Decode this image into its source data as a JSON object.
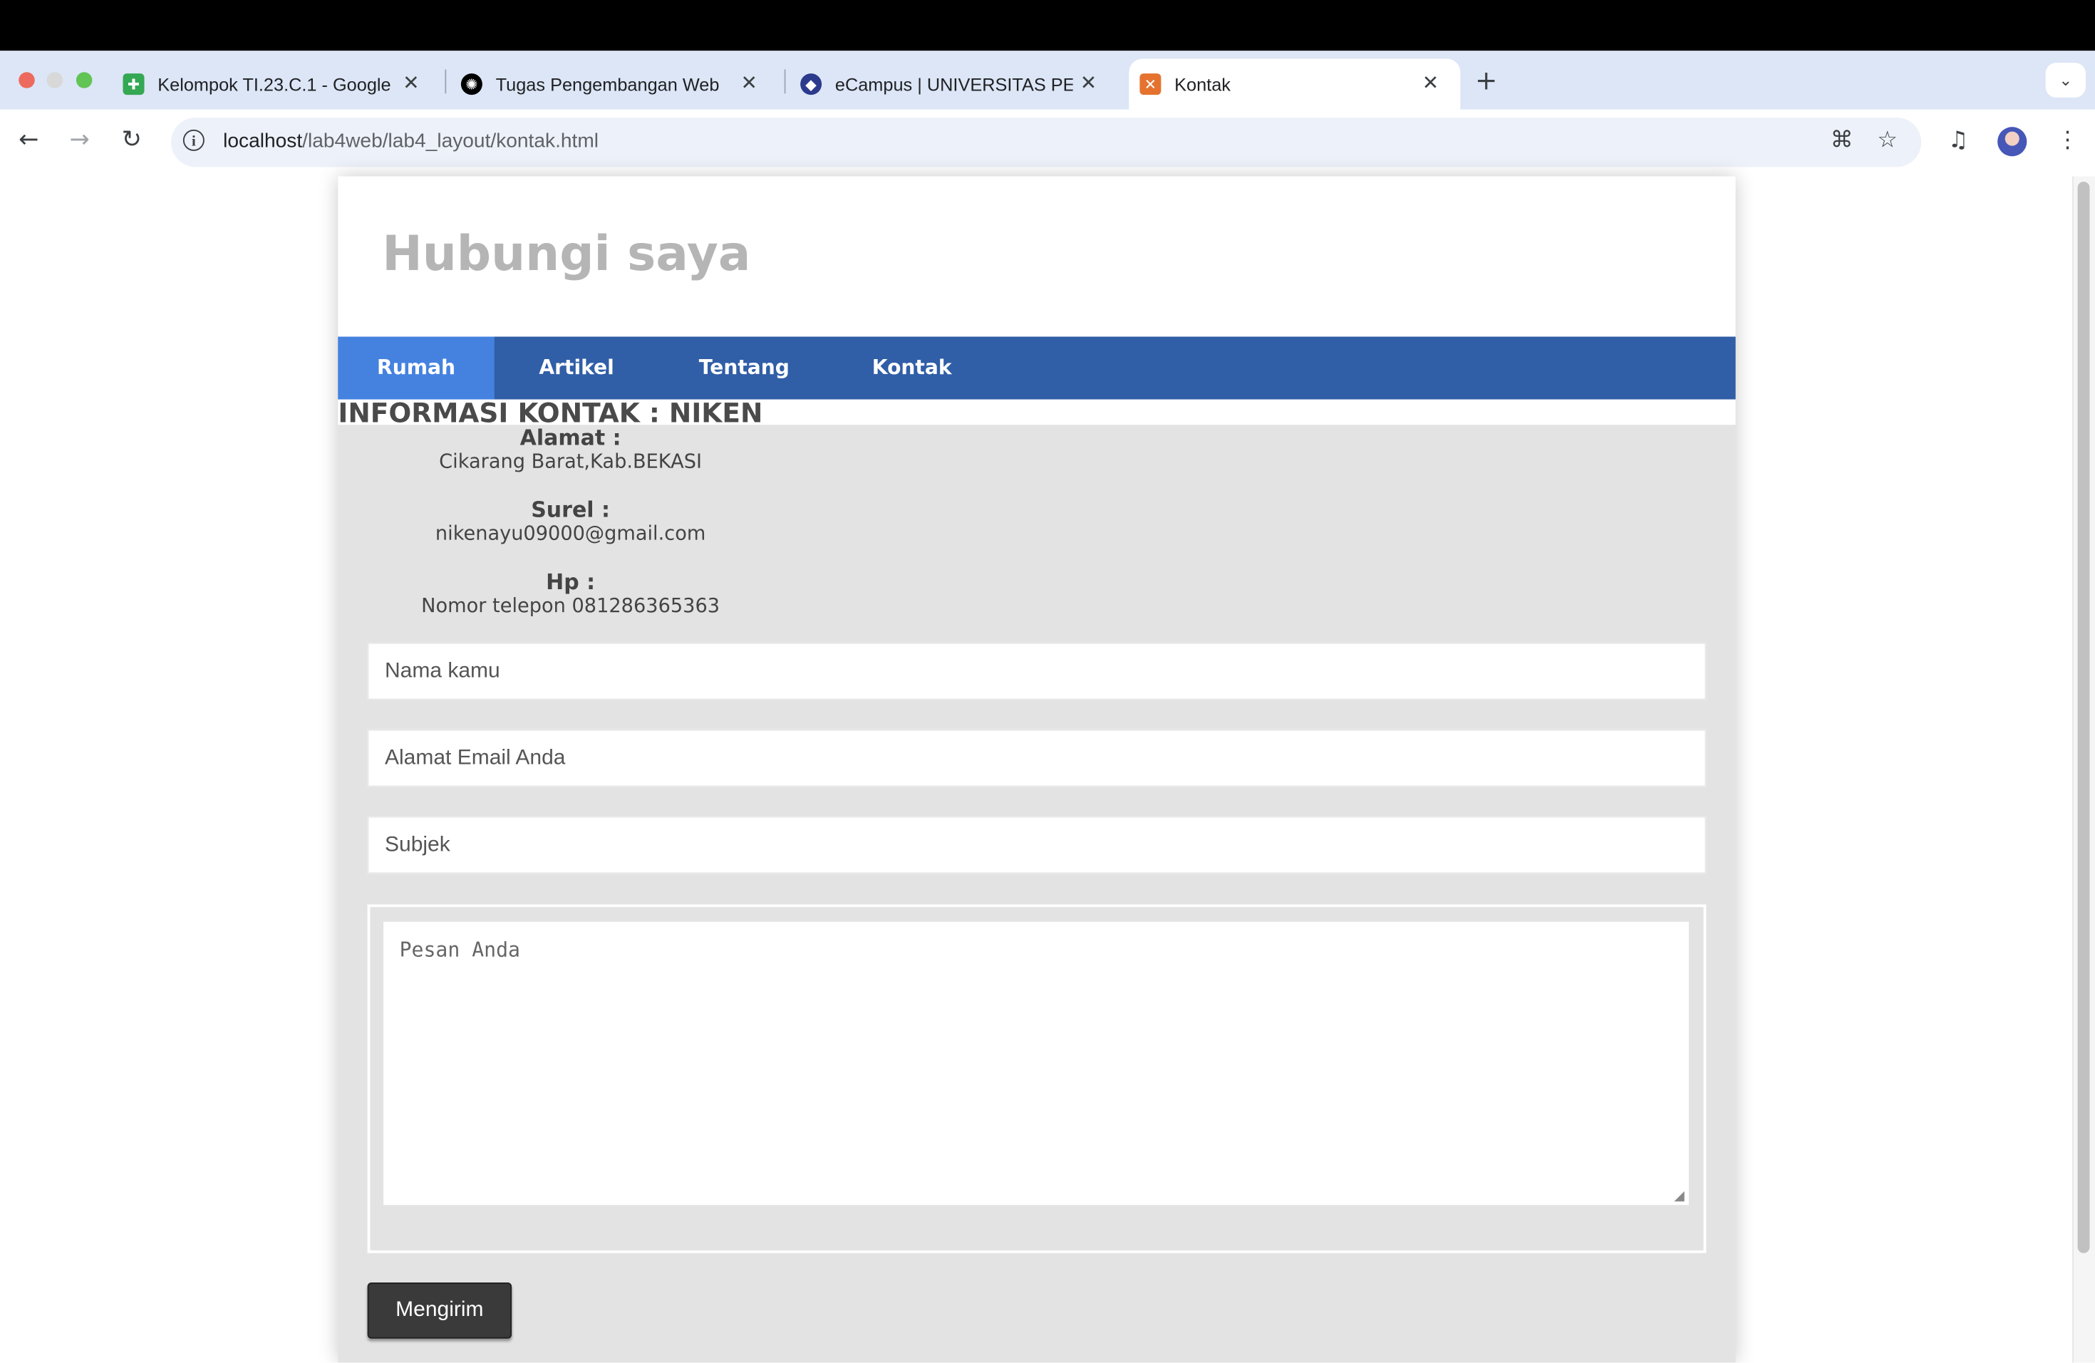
{
  "browser": {
    "tabs": [
      {
        "title": "Kelompok TI.23.C.1 - Google",
        "icon": "sheets-icon",
        "color": "#34a853"
      },
      {
        "title": "Tugas Pengembangan Web",
        "icon": "openai-icon",
        "color": "#000000"
      },
      {
        "title": "eCampus | UNIVERSITAS PEL",
        "icon": "campus-icon",
        "color": "#2b3a8c"
      },
      {
        "title": "Kontak",
        "icon": "xampp-icon",
        "color": "#e5732f"
      }
    ],
    "active_tab_index": 3,
    "url_host": "localhost",
    "url_path": "/lab4web/lab4_layout/kontak.html"
  },
  "site": {
    "title": "Hubungi saya",
    "nav": [
      "Rumah",
      "Artikel",
      "Tentang",
      "Kontak"
    ],
    "active_nav_index": 0
  },
  "contact": {
    "heading": "INFORMASI KONTAK : NIKEN",
    "address_label": "Alamat :",
    "address_value": "Cikarang Barat,Kab.BEKASI",
    "email_label": "Surel :",
    "email_value": "nikenayu09000@gmail.com",
    "phone_label": "Hp :",
    "phone_value": "Nomor telepon 081286365363"
  },
  "form": {
    "name_placeholder": "Nama kamu",
    "email_placeholder": "Alamat Email Anda",
    "subject_placeholder": "Subjek",
    "message_placeholder": "Pesan Anda",
    "submit_label": "Mengirim"
  },
  "colors": {
    "nav_bg": "#305ea7",
    "nav_active": "#4582e0",
    "content_bg": "#e3e3e3",
    "title_gray": "#b5b5b5",
    "button_bg": "#3a3a3a"
  }
}
